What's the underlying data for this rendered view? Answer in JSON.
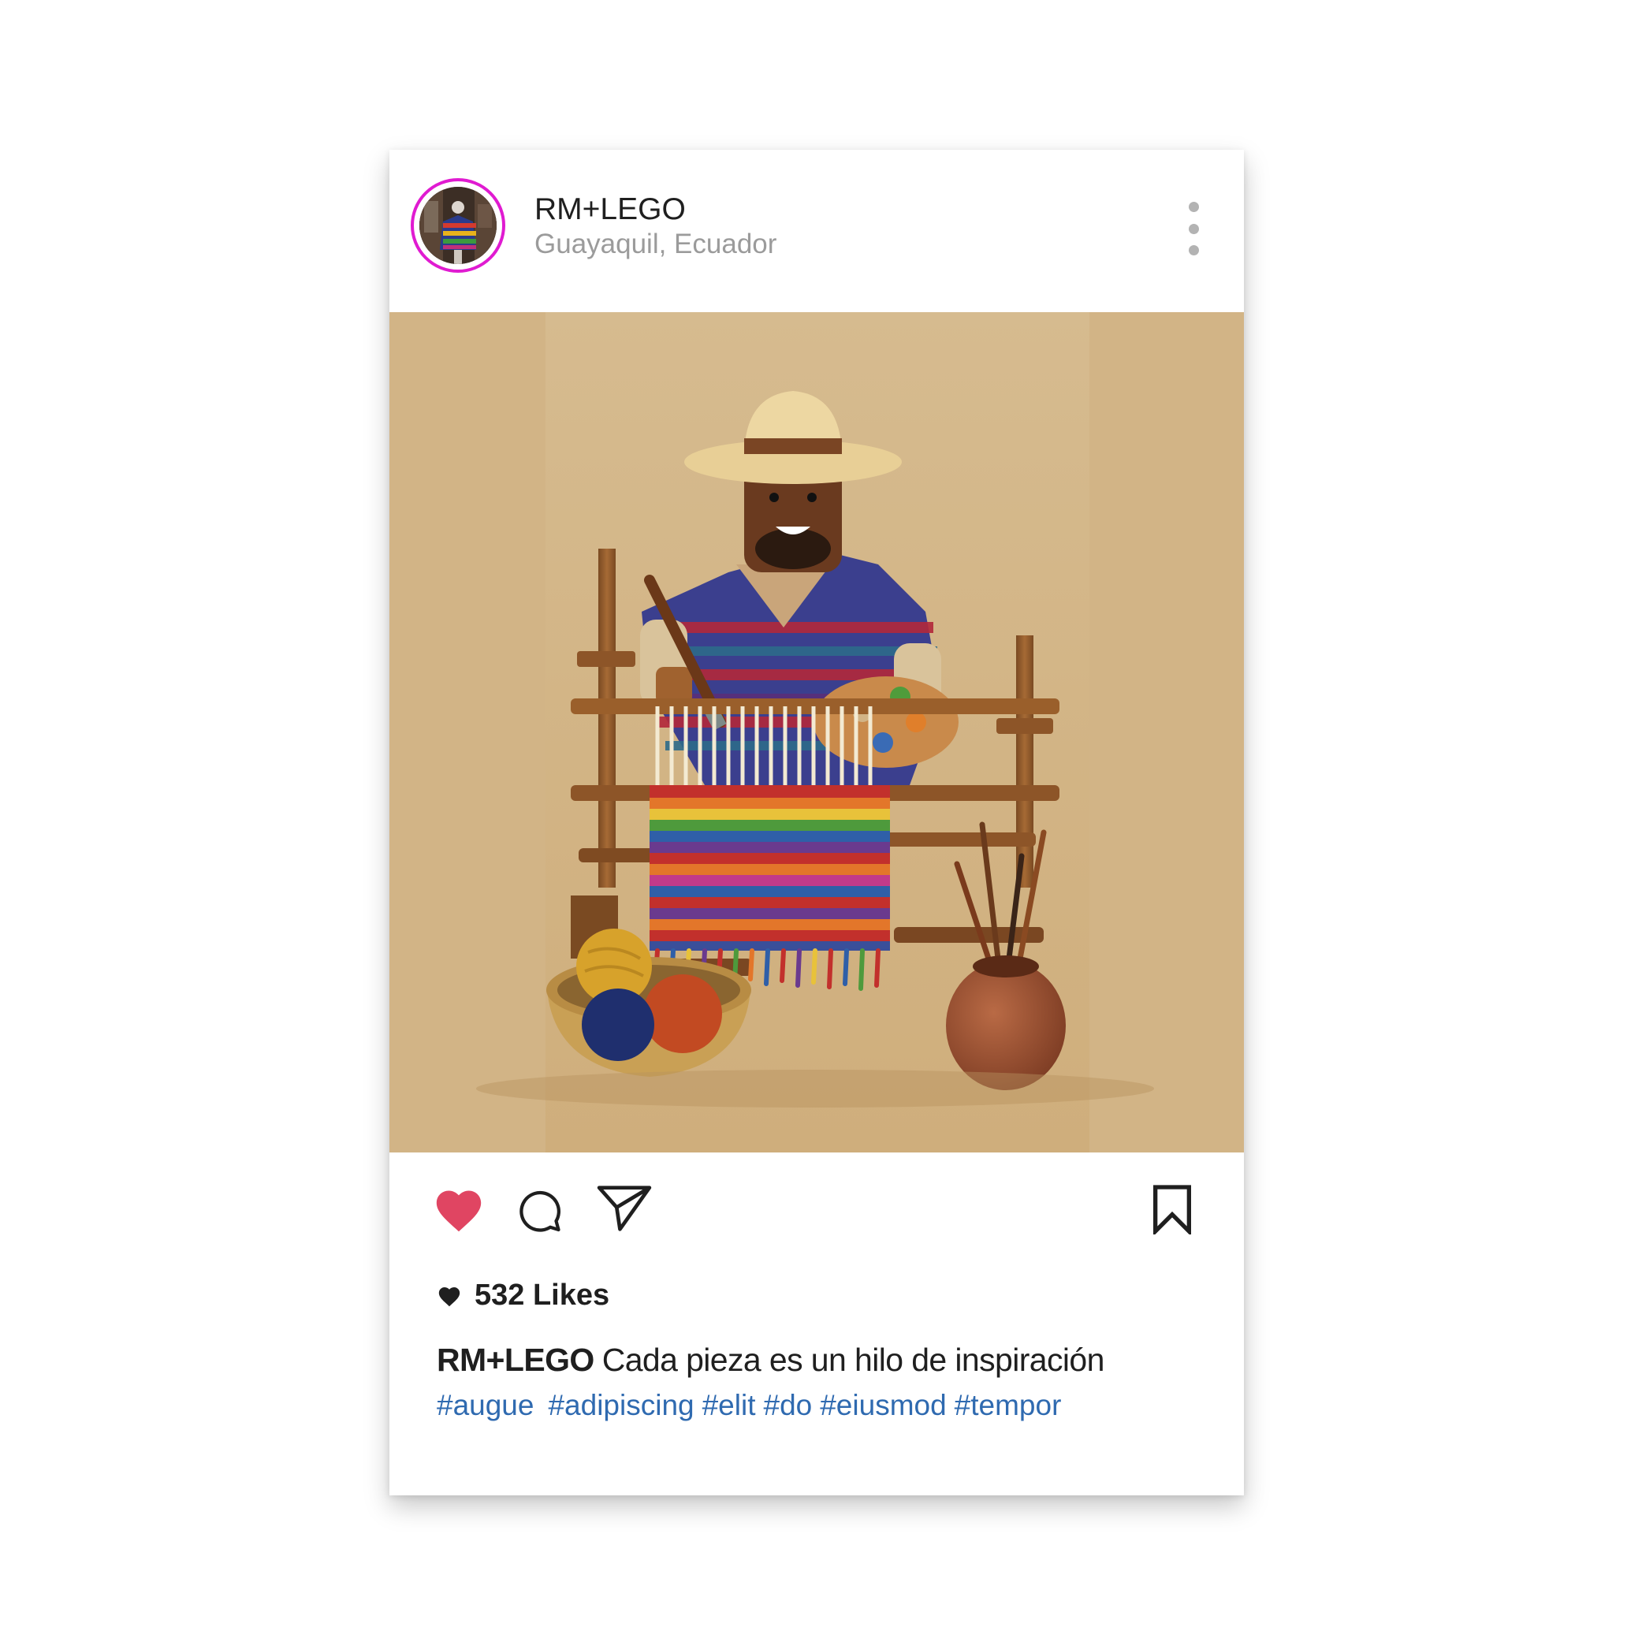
{
  "post": {
    "username": "RM+LEGO",
    "location": "Guayaquil, Ecuador",
    "likes_text": "532 Likes",
    "caption_user": "RM+LEGO",
    "caption_text": "Cada pieza es un hilo de inspiración",
    "hashtags": [
      "#augue",
      "#adipiscing",
      "#elit",
      "#do",
      "#eiusmod",
      "#tempor"
    ],
    "liked": true
  },
  "icons": {
    "more": "more-vertical-icon",
    "like": "heart-icon",
    "comment": "comment-bubble-icon",
    "share": "paper-plane-icon",
    "save": "bookmark-icon"
  },
  "colors": {
    "avatar_ring": "#e01bd1",
    "like_active": "#e04562",
    "hashtag": "#2f6ab0",
    "photo_background": "#d2b486"
  }
}
